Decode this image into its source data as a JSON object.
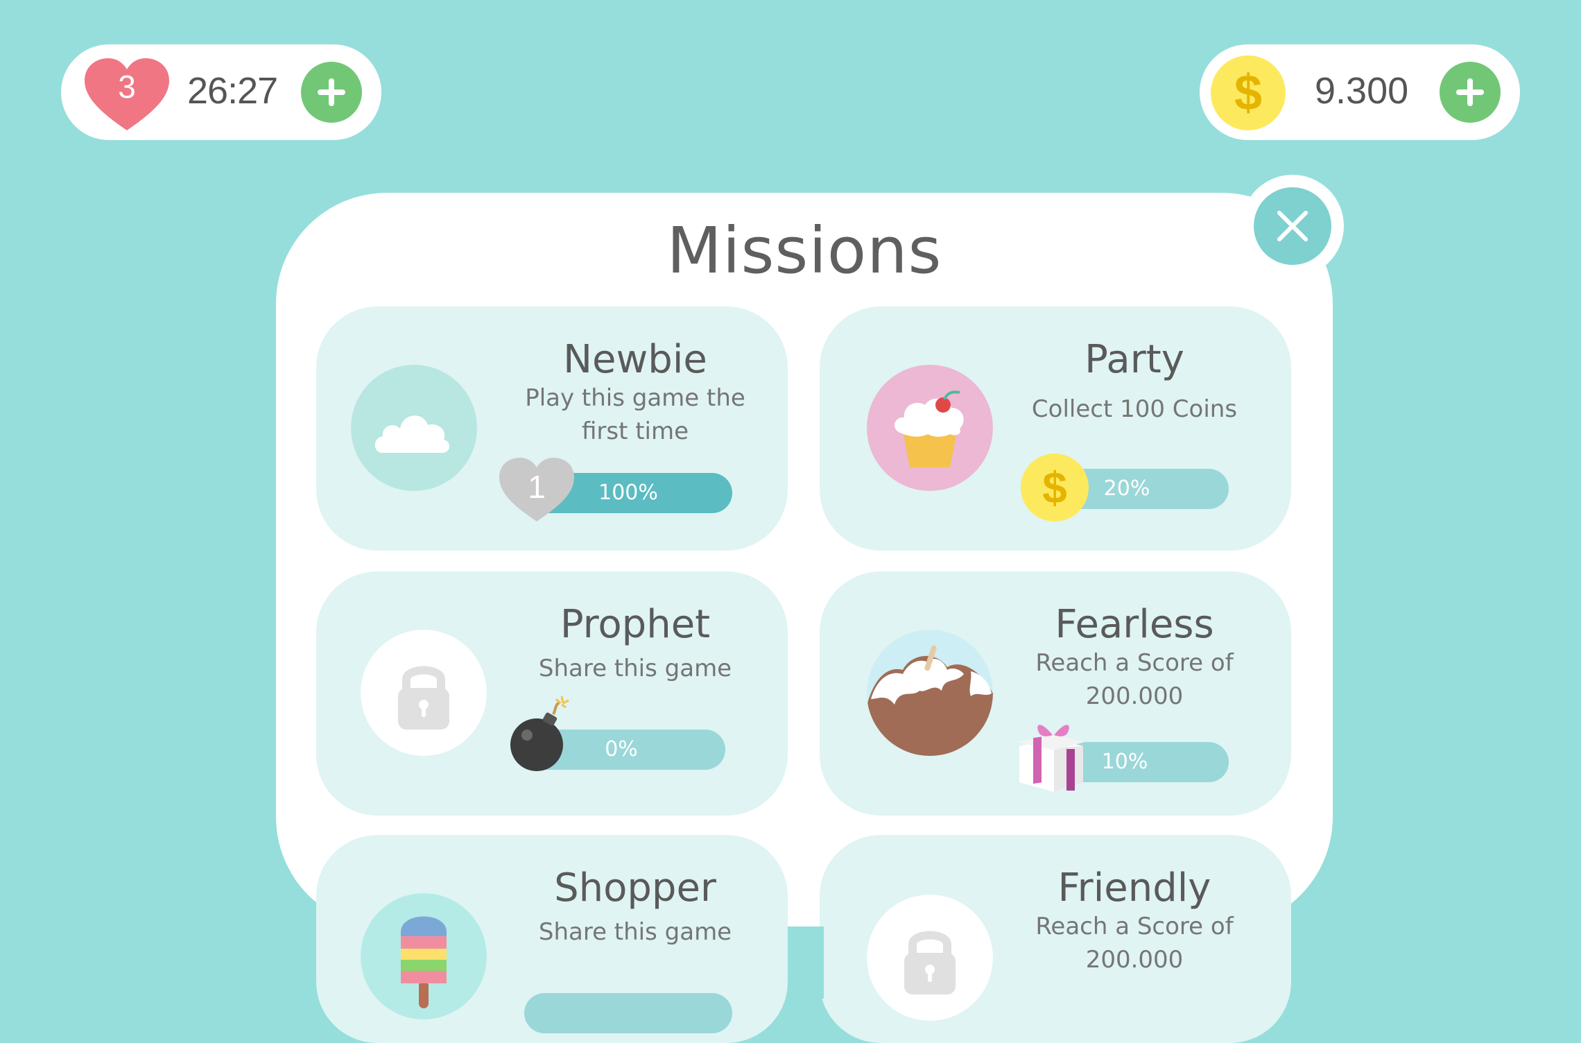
{
  "hud": {
    "lives": "3",
    "timer": "26:27",
    "coins": "9.300",
    "coin_symbol": "$"
  },
  "panel": {
    "title": "Missions"
  },
  "missions": [
    {
      "title": "Newbie",
      "desc": "Play this game the first time",
      "progress": "100%",
      "progress_value": 1.0,
      "reward_icon": "heart-icon",
      "reward_count": "1",
      "badge": "cloud-badge"
    },
    {
      "title": "Party",
      "desc": "Collect 100 Coins",
      "progress": "20%",
      "progress_value": 0.2,
      "reward_icon": "coin-icon",
      "reward_symbol": "$",
      "badge": "cupcake-badge"
    },
    {
      "title": "Prophet",
      "desc": "Share this game",
      "progress": "0%",
      "progress_value": 0.0,
      "reward_icon": "bomb-icon",
      "badge": "lock-badge"
    },
    {
      "title": "Fearless",
      "desc": "Reach a Score of 200.000",
      "progress": "10%",
      "progress_value": 0.1,
      "reward_icon": "gift-icon",
      "badge": "mountain-badge"
    },
    {
      "title": "Shopper",
      "desc": "Share this game",
      "badge": "popsicle-badge"
    },
    {
      "title": "Friendly",
      "desc": "Reach a Score of 200.000",
      "badge": "lock-badge"
    }
  ],
  "colors": {
    "background": "#95dedb",
    "card": "#dff4f3",
    "progress_fill": "#5bbcc2",
    "progress_track": "#9ad7d8",
    "heart": "#f07684",
    "coin": "#fde95d",
    "plus": "#72c776"
  }
}
